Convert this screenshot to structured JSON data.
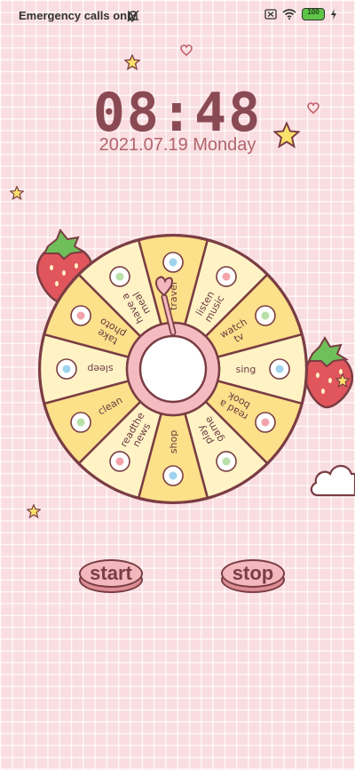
{
  "status_bar": {
    "carrier": "Emergency calls only",
    "battery": "100"
  },
  "clock": {
    "time": "08:48",
    "date": "2021.07.19 Monday"
  },
  "wheel": {
    "segments": [
      {
        "label": "travel",
        "icon": "airplane-icon"
      },
      {
        "label": "listen music",
        "icon": "vinyl-record-icon"
      },
      {
        "label": "watch tv",
        "icon": "tv-icon"
      },
      {
        "label": "sing",
        "icon": "microphone-icon"
      },
      {
        "label": "read a book",
        "icon": "book-icon"
      },
      {
        "label": "play game",
        "icon": "gamepad-icon"
      },
      {
        "label": "shop",
        "icon": "shopping-bag-icon"
      },
      {
        "label": "readthe news",
        "icon": "news-icon"
      },
      {
        "label": "clean",
        "icon": "broom-icon"
      },
      {
        "label": "sleep",
        "icon": "nightcap-icon"
      },
      {
        "label": "take photo",
        "icon": "camera-icon"
      },
      {
        "label": "have a meal",
        "icon": "rice-bowl-icon"
      }
    ],
    "colors": {
      "light": "#fff3c6",
      "dark": "#fde08a",
      "border": "#7a3d43",
      "hub": "#f4bcc1"
    }
  },
  "buttons": {
    "start": "start",
    "stop": "stop"
  }
}
